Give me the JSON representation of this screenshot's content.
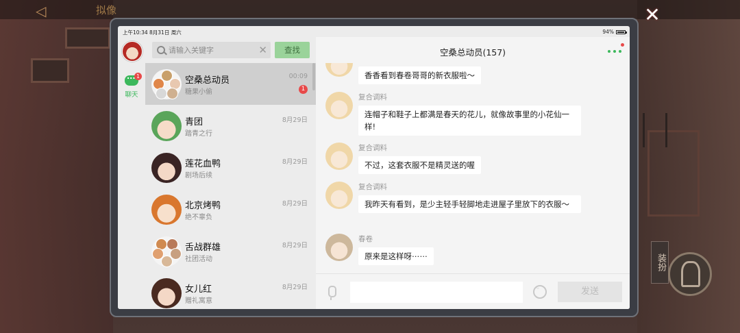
{
  "background": {
    "back_icon": "◁",
    "title": "拟像"
  },
  "close_icon": "✕",
  "statusbar": {
    "time": "上午10:34  8月31日 周六",
    "battery": "94%"
  },
  "rail": {
    "chat_tab_label": "聊天",
    "chat_badge": "1"
  },
  "search": {
    "placeholder": "请输入关键字",
    "clear": "✕",
    "button": "查找"
  },
  "conversations": [
    {
      "name": "空桑总动员",
      "subtitle": "糖果小偷",
      "time": "00:09",
      "badge": "1"
    },
    {
      "name": "青团",
      "subtitle": "踏青之行",
      "time": "8月29日"
    },
    {
      "name": "莲花血鸭",
      "subtitle": "剧场后续",
      "time": "8月29日"
    },
    {
      "name": "北京烤鸭",
      "subtitle": "绝不辜负",
      "time": "8月29日"
    },
    {
      "name": "舌战群雄",
      "subtitle": "社团活动",
      "time": "8月29日"
    },
    {
      "name": "女儿红",
      "subtitle": "赠礼寓意",
      "time": "8月29日"
    }
  ],
  "chat": {
    "title": "空桑总动员(157)",
    "messages": [
      {
        "sender": "",
        "text": "香香看到春卷哥哥的新衣服啦～"
      },
      {
        "sender": "复合调料",
        "text": "连帽子和鞋子上都满是春天的花儿，就像故事里的小花仙一样!"
      },
      {
        "sender": "复合调料",
        "text": "不过，这套衣服不是精灵送的喔"
      },
      {
        "sender": "复合调料",
        "text": "我昨天有看到，是少主轻手轻脚地走进屋子里放下的衣服～"
      },
      {
        "sender": "春卷",
        "text": "原来是这样呀⋯⋯"
      }
    ],
    "send_label": "发送"
  },
  "side_button": "装扮",
  "colors": {
    "accent_green": "#3cb85c",
    "badge_red": "#e84a4a",
    "find_button": "#9ad39a"
  }
}
